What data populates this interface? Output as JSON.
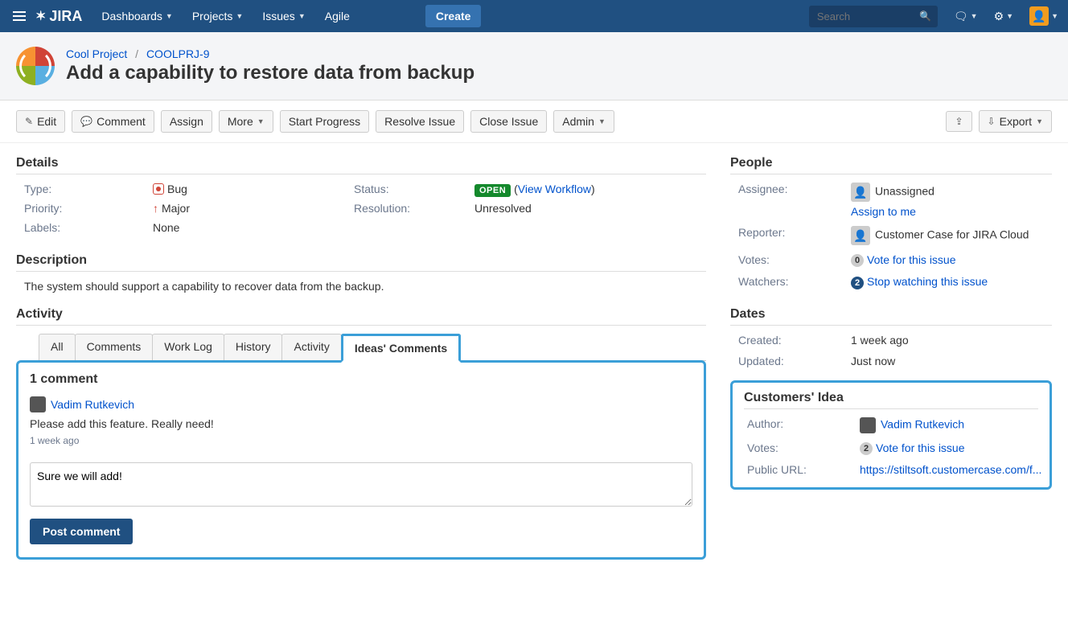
{
  "nav": {
    "logo": "JIRA",
    "items": [
      "Dashboards",
      "Projects",
      "Issues",
      "Agile"
    ],
    "create": "Create",
    "search_placeholder": "Search"
  },
  "breadcrumb": {
    "project": "Cool Project",
    "issue_key": "COOLPRJ-9"
  },
  "issue": {
    "title": "Add a capability to restore data from backup"
  },
  "toolbar": {
    "edit": "Edit",
    "comment": "Comment",
    "assign": "Assign",
    "more": "More",
    "start_progress": "Start Progress",
    "resolve": "Resolve Issue",
    "close": "Close Issue",
    "admin": "Admin",
    "export": "Export"
  },
  "details": {
    "heading": "Details",
    "type_label": "Type:",
    "type_value": "Bug",
    "status_label": "Status:",
    "status_value": "OPEN",
    "view_workflow": "View Workflow",
    "priority_label": "Priority:",
    "priority_value": "Major",
    "resolution_label": "Resolution:",
    "resolution_value": "Unresolved",
    "labels_label": "Labels:",
    "labels_value": "None"
  },
  "description": {
    "heading": "Description",
    "text": "The system should support a capability to recover data from the backup."
  },
  "activity": {
    "heading": "Activity",
    "tabs": [
      "All",
      "Comments",
      "Work Log",
      "History",
      "Activity",
      "Ideas' Comments"
    ],
    "active_tab": 5,
    "ideas": {
      "count_label": "1 comment",
      "comment": {
        "author": "Vadim Rutkevich",
        "body": "Please add this feature. Really need!",
        "time": "1 week ago"
      },
      "draft": "Sure we will add!",
      "post": "Post comment"
    }
  },
  "people": {
    "heading": "People",
    "assignee_label": "Assignee:",
    "assignee_value": "Unassigned",
    "assign_to_me": "Assign to me",
    "reporter_label": "Reporter:",
    "reporter_value": "Customer Case for JIRA Cloud",
    "votes_label": "Votes:",
    "votes_count": "0",
    "votes_action": "Vote for this issue",
    "watchers_label": "Watchers:",
    "watchers_count": "2",
    "watchers_action": "Stop watching this issue"
  },
  "dates": {
    "heading": "Dates",
    "created_label": "Created:",
    "created_value": "1 week ago",
    "updated_label": "Updated:",
    "updated_value": "Just now"
  },
  "idea": {
    "heading": "Customers' Idea",
    "author_label": "Author:",
    "author_value": "Vadim Rutkevich",
    "votes_label": "Votes:",
    "votes_count": "2",
    "votes_action": "Vote for this issue",
    "url_label": "Public URL:",
    "url_value": "https://stiltsoft.customercase.com/f..."
  }
}
